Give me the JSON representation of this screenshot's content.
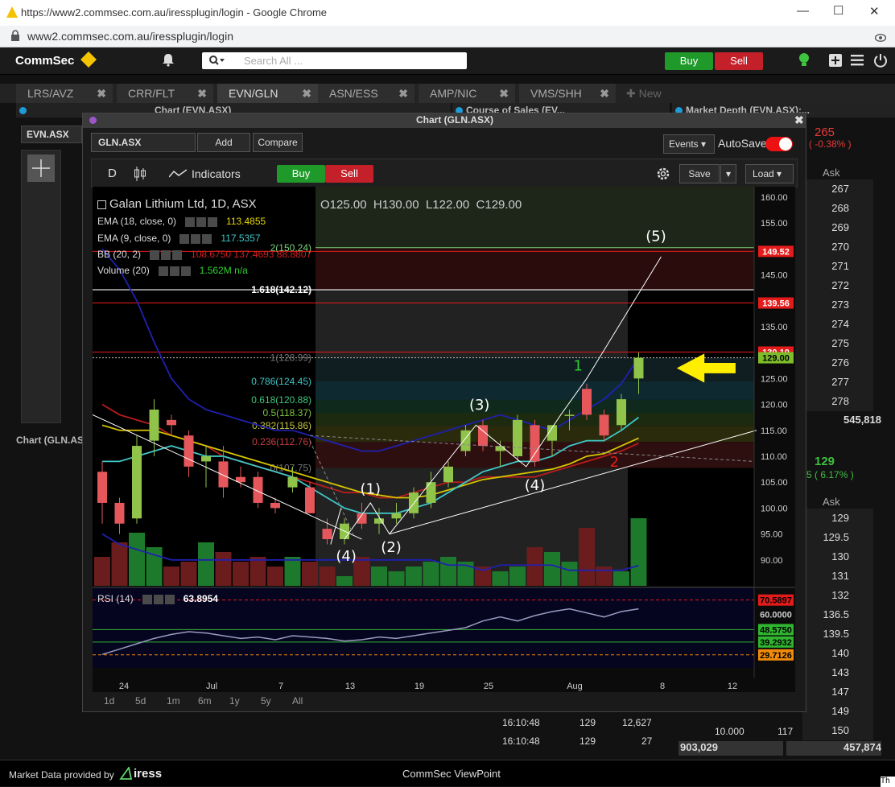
{
  "browser": {
    "title": "https://www2.commsec.com.au/iressplugin/login - Google Chrome",
    "url": "www2.commsec.com.au/iressplugin/login",
    "minimize": "—",
    "maximize": "☐",
    "close": "✕"
  },
  "app": {
    "brand": "CommSec",
    "search_placeholder": "Search All ...",
    "buy": "Buy",
    "sell": "Sell"
  },
  "tabs": [
    {
      "label": "LRS/AVZ"
    },
    {
      "label": "CRR/FLT"
    },
    {
      "label": "EVN/GLN"
    },
    {
      "label": "ASN/ESS"
    },
    {
      "label": "AMP/NIC"
    },
    {
      "label": "VMS/SHH"
    },
    {
      "label": "New"
    }
  ],
  "panels": {
    "chart_evn": "Chart (EVN.ASX)",
    "course_of_sales": "Course of Sales (EV...",
    "market_depth": "Market Depth (EVN.ASX):...",
    "evn_symbol": "EVN.ASX",
    "chart_gln_tab": "Chart (GLN.ASX"
  },
  "chart_window": {
    "title": "Chart (GLN.ASX)",
    "symbol": "GLN.ASX",
    "add": "Add",
    "compare": "Compare",
    "events": "Events",
    "autosave": "AutoSave",
    "interval": "D",
    "indicators": "Indicators",
    "buy": "Buy",
    "sell": "Sell",
    "save": "Save",
    "load": "Load",
    "instrument": "Galan Lithium Ltd, 1D, ASX",
    "ohlc": {
      "o": "O125.00",
      "h": "H130.00",
      "l": "L122.00",
      "c": "C129.00"
    },
    "indicators_list": [
      {
        "name": "EMA (18, close, 0)",
        "value": "113.4855",
        "color": "#e6d600"
      },
      {
        "name": "EMA (9, close, 0)",
        "value": "117.5357",
        "color": "#3fc6c6"
      },
      {
        "name": "BB (20, 2)",
        "value": "108.6750   137.4693   88.8807",
        "color": "#d02020"
      },
      {
        "name": "Volume (20)",
        "value": "1.562M   n/a",
        "color": "#2aa02a"
      }
    ],
    "rsi": {
      "name": "RSI (14)",
      "value": "63.8954"
    },
    "timeframes": [
      "1d",
      "5d",
      "1m",
      "6m",
      "1y",
      "5y",
      "All"
    ]
  },
  "chart_data": {
    "type": "candlestick",
    "title": "Galan Lithium Ltd, 1D, ASX",
    "ylim": [
      85,
      162
    ],
    "y_ticks": [
      "160.00",
      "155.00",
      "150.00",
      "145.00",
      "140.00",
      "135.00",
      "130.00",
      "125.00",
      "120.00",
      "115.00",
      "110.00",
      "105.00",
      "100.00",
      "95.00",
      "90.00"
    ],
    "x_ticks": [
      "24",
      "Jul",
      "7",
      "13",
      "19",
      "25",
      "Aug",
      "8",
      "12"
    ],
    "price_tags": [
      {
        "label": "149.52",
        "color": "#e31b1b"
      },
      {
        "label": "139.56",
        "color": "#e31b1b"
      },
      {
        "label": "130.10",
        "color": "#e31b1b"
      },
      {
        "label": "129.00",
        "color": "#7dbd2a"
      }
    ],
    "fib_levels": [
      {
        "label": "2(150.24)",
        "value": 150.24
      },
      {
        "label": "1.618(142.12)",
        "value": 142.12
      },
      {
        "label": "1(128.99)",
        "value": 128.99
      },
      {
        "label": "0.786(124.45)",
        "value": 124.45
      },
      {
        "label": "0.618(120.88)",
        "value": 120.88
      },
      {
        "label": "0.5(118.37)",
        "value": 118.37
      },
      {
        "label": "0.382(115.86)",
        "value": 115.86
      },
      {
        "label": "0.236(112.76)",
        "value": 112.76
      },
      {
        "label": "0(107.75)",
        "value": 107.75
      }
    ],
    "waves": [
      "(1)",
      "(2)",
      "(3)",
      "(4)",
      "(4)",
      "(5)",
      "1",
      "2"
    ],
    "candles": [
      {
        "o": 107,
        "h": 109,
        "l": 97,
        "c": 101
      },
      {
        "o": 101,
        "h": 102,
        "l": 95,
        "c": 97
      },
      {
        "o": 98,
        "h": 114,
        "l": 97,
        "c": 112
      },
      {
        "o": 113,
        "h": 121,
        "l": 110,
        "c": 119
      },
      {
        "o": 117,
        "h": 118,
        "l": 114,
        "c": 116
      },
      {
        "o": 114,
        "h": 115,
        "l": 106,
        "c": 108
      },
      {
        "o": 109,
        "h": 112,
        "l": 104,
        "c": 110
      },
      {
        "o": 109,
        "h": 112,
        "l": 102,
        "c": 104
      },
      {
        "o": 106,
        "h": 108,
        "l": 104,
        "c": 105
      },
      {
        "o": 106,
        "h": 107,
        "l": 100,
        "c": 101
      },
      {
        "o": 101,
        "h": 102,
        "l": 99,
        "c": 100
      },
      {
        "o": 104,
        "h": 108,
        "l": 103,
        "c": 106
      },
      {
        "o": 104,
        "h": 105,
        "l": 99,
        "c": 99
      },
      {
        "o": 96,
        "h": 98,
        "l": 93,
        "c": 94
      },
      {
        "o": 94,
        "h": 98,
        "l": 93,
        "c": 97
      },
      {
        "o": 99,
        "h": 101,
        "l": 96,
        "c": 97
      },
      {
        "o": 97,
        "h": 100,
        "l": 95,
        "c": 98
      },
      {
        "o": 98,
        "h": 101,
        "l": 97,
        "c": 99
      },
      {
        "o": 99,
        "h": 104,
        "l": 98,
        "c": 103
      },
      {
        "o": 101,
        "h": 107,
        "l": 100,
        "c": 105
      },
      {
        "o": 105,
        "h": 109,
        "l": 104,
        "c": 108
      },
      {
        "o": 111,
        "h": 116,
        "l": 110,
        "c": 115
      },
      {
        "o": 116,
        "h": 117,
        "l": 111,
        "c": 112
      },
      {
        "o": 111,
        "h": 113,
        "l": 108,
        "c": 112
      },
      {
        "o": 110,
        "h": 118,
        "l": 109,
        "c": 117
      },
      {
        "o": 116,
        "h": 117,
        "l": 108,
        "c": 109
      },
      {
        "o": 113,
        "h": 116,
        "l": 110,
        "c": 116
      },
      {
        "o": 118,
        "h": 119,
        "l": 115,
        "c": 118
      },
      {
        "o": 123,
        "h": 124,
        "l": 117,
        "c": 118
      },
      {
        "o": 118,
        "h": 119,
        "l": 113,
        "c": 114
      },
      {
        "o": 116,
        "h": 122,
        "l": 115,
        "c": 121
      },
      {
        "o": 125,
        "h": 130,
        "l": 122,
        "c": 129
      }
    ],
    "volume": [
      0.6,
      0.9,
      1.1,
      0.8,
      0.4,
      0.5,
      0.9,
      0.7,
      0.5,
      0.6,
      0.4,
      0.6,
      0.5,
      0.4,
      0.2,
      0.6,
      0.4,
      0.3,
      0.4,
      0.5,
      0.6,
      0.5,
      0.4,
      0.3,
      0.4,
      0.8,
      0.7,
      0.5,
      1.2,
      0.4,
      0.3,
      1.4
    ],
    "rsi_values": [
      30,
      34,
      38,
      42,
      45,
      47,
      46,
      44,
      42,
      43,
      41,
      44,
      43,
      42,
      40,
      41,
      43,
      42,
      44,
      46,
      48,
      50,
      55,
      58,
      55,
      59,
      62,
      64,
      61,
      58,
      62,
      64
    ],
    "rsi_levels": [
      {
        "label": "70.5897",
        "color": "#e31b1b"
      },
      {
        "label": "60.0000",
        "color": "#333333"
      },
      {
        "label": "48.5750",
        "color": "#2fb52f"
      },
      {
        "label": "39.2932",
        "color": "#2fb52f"
      },
      {
        "label": "29.7126",
        "color": "#f08a0a"
      }
    ]
  },
  "market_depth": {
    "bid_header": "265",
    "bid_change": "( -0.38% )",
    "ask_header": "Ask",
    "asks": [
      "267",
      "268",
      "269",
      "270",
      "271",
      "272",
      "273",
      "274",
      "275",
      "276",
      "277",
      "278"
    ],
    "total": "545,818",
    "gln_price": "129",
    "gln_change": "5 ( 6.17% )",
    "ask_header2": "Ask",
    "asks2": [
      "129",
      "129.5",
      "130",
      "131",
      "132",
      "136.5",
      "139.5",
      "140",
      "143",
      "147",
      "149",
      "150"
    ],
    "bottom_left": "903,029",
    "bottom_right": "457,874",
    "bottom_price": "10.000",
    "bottom_qty": "117"
  },
  "course_of_sales": {
    "rows": [
      {
        "time": "16:10:48",
        "price": "129",
        "vol": "12,627"
      },
      {
        "time": "16:10:48",
        "price": "129",
        "vol": "27"
      }
    ]
  },
  "footer": {
    "provider": "Market Data provided by",
    "iress": "iress",
    "app_name": "CommSec ViewPoint",
    "right": "Th"
  }
}
